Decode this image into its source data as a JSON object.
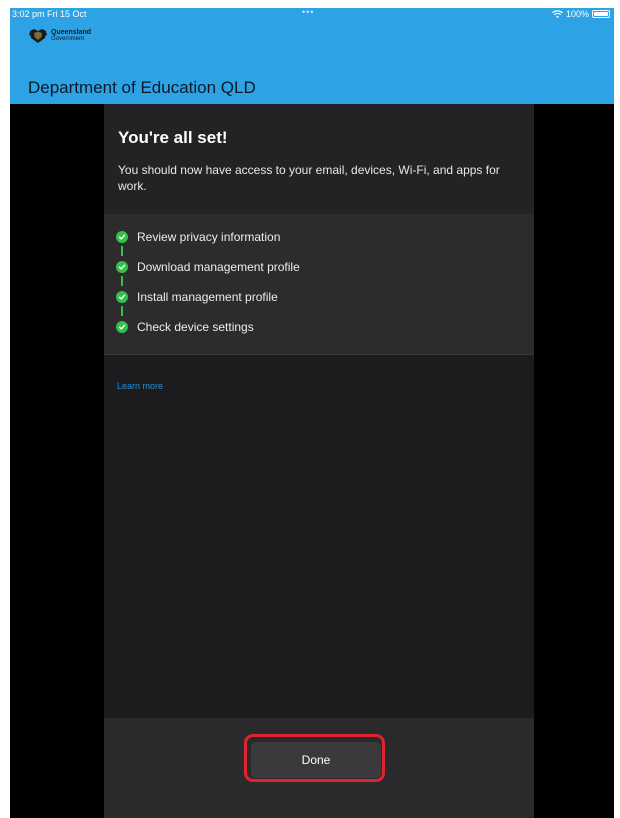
{
  "status_bar": {
    "time": "3:02 pm  Fri 15 Oct",
    "dots": "•••",
    "battery": "100%",
    "icons": [
      "wifi-icon",
      "battery-icon"
    ]
  },
  "header": {
    "logo_line1": "Queensland",
    "logo_line2": "Government",
    "title": "Department of Education QLD",
    "color": "#2da3e6"
  },
  "panel": {
    "title": "You're all set!",
    "description": "You should now have access to your email, devices, Wi-Fi, and apps for work.",
    "checklist": [
      {
        "label": "Review privacy information",
        "status": "done"
      },
      {
        "label": "Download management profile",
        "status": "done"
      },
      {
        "label": "Install management profile",
        "status": "done"
      },
      {
        "label": "Check device settings",
        "status": "done"
      }
    ],
    "learn_more": "Learn more",
    "check_color": "#33c14a",
    "link_color": "#1e8ee5"
  },
  "footer": {
    "done_label": "Done",
    "highlight_color": "#e0232e"
  }
}
